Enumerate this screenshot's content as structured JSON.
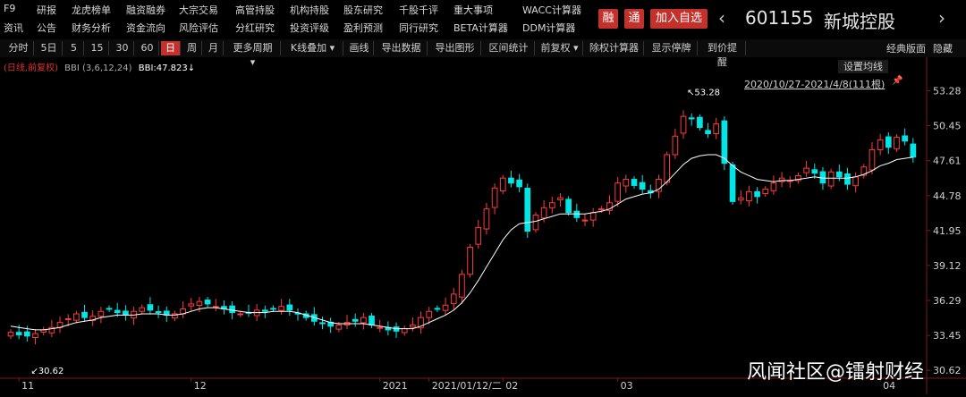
{
  "menu_row1": [
    "F9",
    "研报",
    "龙虎榜单",
    "融资融券",
    "大宗交易",
    "高管持股",
    "机构持股",
    "股东研究",
    "千股千评",
    "重大事项",
    "WACC计算器"
  ],
  "menu_row2": [
    "资讯",
    "公告",
    "财务分析",
    "资金流向",
    "风险评估",
    "分红研究",
    "投资评级",
    "盈利预测",
    "同行研究",
    "BETA计算器",
    "DDM计算器"
  ],
  "badges": {
    "rong": "融",
    "tong": "通"
  },
  "add_watch": "加入自选",
  "stock": {
    "code": "601155",
    "name": "新城控股"
  },
  "toolbar": [
    "分时",
    "5日",
    "5",
    "15",
    "30",
    "60",
    "日",
    "周",
    "月",
    "更多周期",
    "K线叠加",
    "画线",
    "导出数据",
    "导出图形",
    "区间统计",
    "前复权",
    "除权计算器",
    "显示停牌",
    "到价提醒"
  ],
  "toolbar_active": "日",
  "right_tools": {
    "layout": "经典版面",
    "hide": "隐藏"
  },
  "indicator": {
    "mode": "(日线,前复权)",
    "name": "BBI (3,6,12,24)",
    "value": "BBI:47.823↓"
  },
  "set_ma": "设置均线",
  "range_text": "2020/10/27-2021/4/8(111根)",
  "watermark": "风闻社区@镭射财经",
  "colors": {
    "up": "#ff3b3b",
    "down": "#00e5e5",
    "bbi": "#ffffff",
    "axis": "#7a1a1a",
    "accent": "#c4302b"
  },
  "chart_data": {
    "type": "candlestick",
    "y_ticks": [
      53.28,
      50.45,
      47.61,
      44.78,
      41.95,
      39.12,
      36.29,
      33.45,
      30.62
    ],
    "ylim": [
      30.2,
      54.4
    ],
    "x_labels": [
      {
        "i": 1,
        "t": "11"
      },
      {
        "i": 22,
        "t": "12"
      },
      {
        "i": 45,
        "t": "2021"
      },
      {
        "i": 51,
        "t": "2021/01/12/二"
      },
      {
        "i": 60,
        "t": "02"
      },
      {
        "i": 74,
        "t": "03"
      },
      {
        "i": 106,
        "t": "04"
      }
    ],
    "annotations": {
      "high": "53.28",
      "low": "30.62"
    },
    "closes": [
      33.7,
      33.5,
      33.4,
      33.6,
      33.9,
      34.1,
      34.5,
      34.8,
      35.2,
      34.9,
      35.0,
      35.4,
      35.6,
      35.3,
      35.1,
      35.4,
      35.7,
      35.5,
      35.3,
      35.1,
      35.2,
      35.6,
      36.0,
      36.2,
      36.0,
      35.8,
      35.6,
      35.3,
      35.2,
      35.3,
      35.5,
      35.4,
      35.6,
      35.8,
      35.5,
      35.2,
      34.9,
      34.6,
      34.4,
      34.2,
      34.3,
      34.5,
      34.6,
      34.9,
      34.3,
      34.1,
      33.9,
      33.8,
      34.0,
      34.3,
      34.9,
      35.4,
      35.6,
      35.9,
      36.8,
      38.4,
      40.6,
      42.2,
      43.7,
      45.4,
      46.2,
      45.8,
      45.5,
      41.9,
      43.2,
      43.8,
      44.2,
      44.6,
      43.4,
      43.0,
      42.8,
      43.4,
      43.7,
      44.2,
      45.8,
      46.1,
      45.6,
      45.3,
      45.0,
      46.1,
      48.1,
      49.6,
      51.2,
      51.0,
      50.3,
      49.8,
      50.6,
      47.4,
      44.3,
      44.6,
      45.1,
      44.7,
      45.3,
      45.8,
      46.2,
      46.0,
      46.4,
      47.0,
      46.6,
      45.8,
      46.7,
      46.3,
      45.7,
      46.3,
      47.1,
      48.5,
      49.3,
      48.7,
      49.5,
      49.2,
      47.9
    ],
    "bbi": [
      34.2,
      34.1,
      34.0,
      33.9,
      33.9,
      34.0,
      34.1,
      34.3,
      34.5,
      34.6,
      34.7,
      34.9,
      35.0,
      35.1,
      35.1,
      35.1,
      35.2,
      35.2,
      35.2,
      35.1,
      35.1,
      35.2,
      35.4,
      35.6,
      35.7,
      35.7,
      35.6,
      35.5,
      35.4,
      35.3,
      35.3,
      35.3,
      35.4,
      35.4,
      35.4,
      35.3,
      35.1,
      34.9,
      34.7,
      34.5,
      34.4,
      34.4,
      34.4,
      34.4,
      34.3,
      34.2,
      34.1,
      34.0,
      34.0,
      34.0,
      34.2,
      34.5,
      34.8,
      35.1,
      35.5,
      36.1,
      36.9,
      37.9,
      39.0,
      40.1,
      41.2,
      42.0,
      42.5,
      42.6,
      42.7,
      42.9,
      43.1,
      43.3,
      43.3,
      43.3,
      43.3,
      43.4,
      43.5,
      43.7,
      44.1,
      44.5,
      44.7,
      44.9,
      45.0,
      45.3,
      45.9,
      46.6,
      47.3,
      47.8,
      48.0,
      48.1,
      48.1,
      47.8,
      47.2,
      46.7,
      46.4,
      46.1,
      46.0,
      45.9,
      46.0,
      46.0,
      46.1,
      46.2,
      46.3,
      46.2,
      46.2,
      46.2,
      46.2,
      46.3,
      46.5,
      46.8,
      47.2,
      47.4,
      47.7,
      47.8,
      47.9
    ]
  }
}
